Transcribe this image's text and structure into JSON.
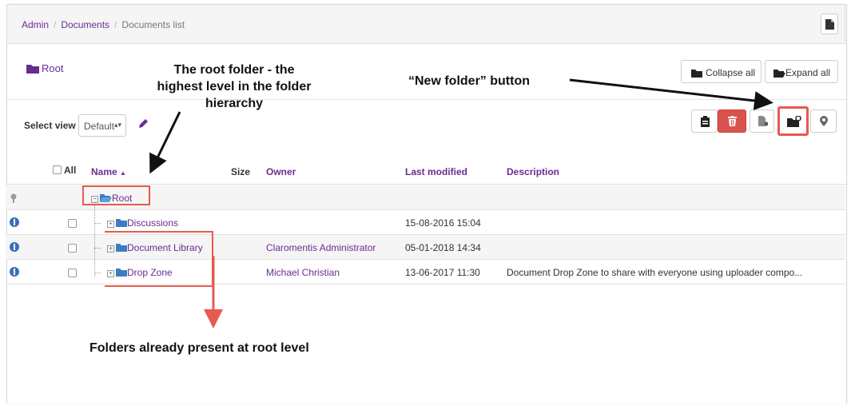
{
  "breadcrumb": {
    "admin": "Admin",
    "documents": "Documents",
    "current": "Documents list"
  },
  "title": "Root",
  "buttons": {
    "collapse_all": "Collapse all",
    "expand_all": "Expand all"
  },
  "select_view": {
    "label": "Select view",
    "value": "Default"
  },
  "table": {
    "headers": {
      "all": "All",
      "name": "Name",
      "size": "Size",
      "owner": "Owner",
      "last_modified": "Last modified",
      "description": "Description"
    },
    "root_row": {
      "name": "Root"
    },
    "rows": [
      {
        "name": "Discussions",
        "owner": "",
        "last_modified": "15-08-2016 15:04",
        "description": ""
      },
      {
        "name": "Document Library",
        "owner": "Claromentis Administrator",
        "last_modified": "05-01-2018 14:34",
        "description": ""
      },
      {
        "name": "Drop Zone",
        "owner": "Michael Christian",
        "last_modified": "13-06-2017 11:30",
        "description": "Document Drop Zone to share with everyone using uploader compo..."
      }
    ]
  },
  "annotations": {
    "root_line1": "The root folder - the",
    "root_line2": "highest level in the folder",
    "root_line3": "hierarchy",
    "new_folder": "“New folder” button",
    "present": "Folders already present at root level"
  },
  "colors": {
    "accent": "#6a2c91",
    "annotation_red": "#e55b4d",
    "delete_red": "#d9534f"
  },
  "icons": [
    "document-icon",
    "folder-icon",
    "folder-open-icon",
    "pencil-icon",
    "clipboard-icon",
    "trash-icon",
    "file-icon",
    "new-folder-icon",
    "map-marker-icon",
    "info-icon",
    "expand-icon"
  ]
}
